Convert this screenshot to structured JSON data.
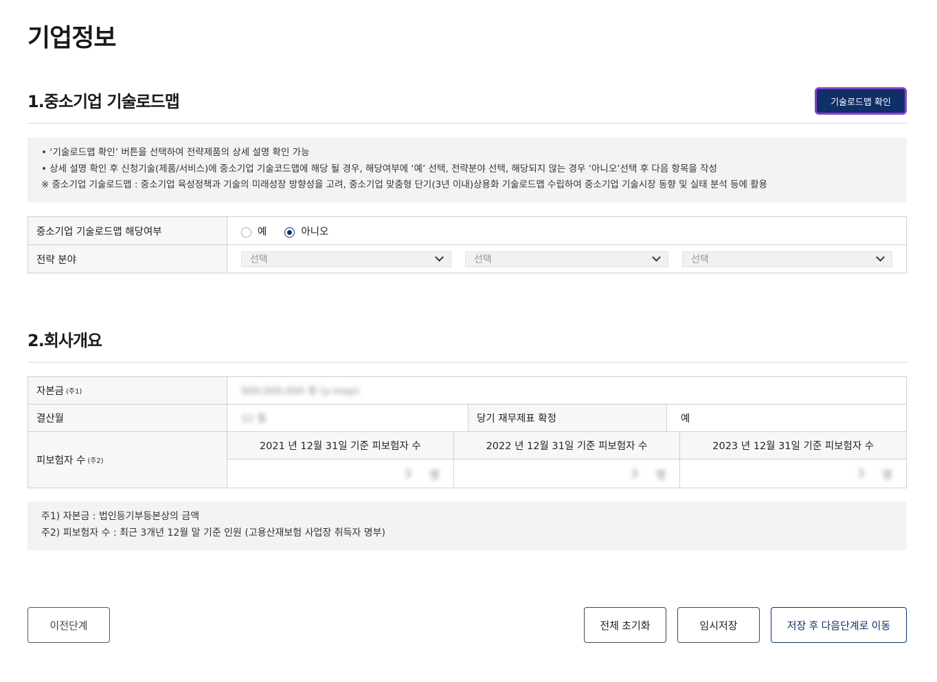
{
  "page_title": "기업정보",
  "section1": {
    "title": "1.중소기업 기술로드맵",
    "roadmap_button": "기술로드맵 확인",
    "notices": [
      "• ‘기술로드맵 확인’ 버튼을 선택하여 전략제품의 상세 설명 확인 가능",
      "• 상세 설명 확인 후 신청기술(제품/서비스)에 중소기업 기술코드맵에 해당 될 경우, 해당여부에 ‘예’ 선택, 전략분야 선택, 해당되지 않는 경우 ‘아니오’선택 후 다음 항목을 작성",
      "※ 중소기업 기술로드맵 : 중소기업 육성정책과 기술의 미래성장 방향성을 고려, 중소기업 맞춤형 단기(3년 이내)상용화 기술로드맵 수립하여 중소기업 기술시장 동향 및 실태 분석 등에 활용"
    ],
    "applicable_label": "중소기업 기술로드맵 해당여부",
    "radio_yes": "예",
    "radio_no": "아니오",
    "selected": "아니오",
    "strategy_label": "전략 분야",
    "selects": [
      "선택",
      "선택",
      "선택"
    ]
  },
  "section2": {
    "title": "2.회사개요",
    "capital_label": "자본금",
    "capital_note": "(주1)",
    "capital_value": "500,000,000 원 (y-mop)",
    "settle_label": "결산월",
    "settle_value": "12 월",
    "fin_label": "당기 재무제표 확정",
    "fin_value": "예",
    "insured_label": "피보험자 수",
    "insured_note": "(주2)",
    "insured_cols": [
      {
        "header": "2021 년 12월 31일 기준 피보험자 수",
        "value": "3",
        "unit": "명"
      },
      {
        "header": "2022 년 12월 31일 기준 피보험자 수",
        "value": "3",
        "unit": "명"
      },
      {
        "header": "2023 년 12월 31일 기준 피보험자 수",
        "value": "3",
        "unit": "명"
      }
    ],
    "footnotes": [
      "주1) 자본금 : 법인등기부등본상의 금액",
      "주2) 피보험자 수 : 최근 3개년 12월 말 기준 인원 (고용산재보험 사업장 취득자 명부)"
    ]
  },
  "buttons": {
    "prev": "이전단계",
    "reset": "전체 초기화",
    "temp_save": "임시저장",
    "save_next": "저장 후 다음단계로 이동"
  }
}
